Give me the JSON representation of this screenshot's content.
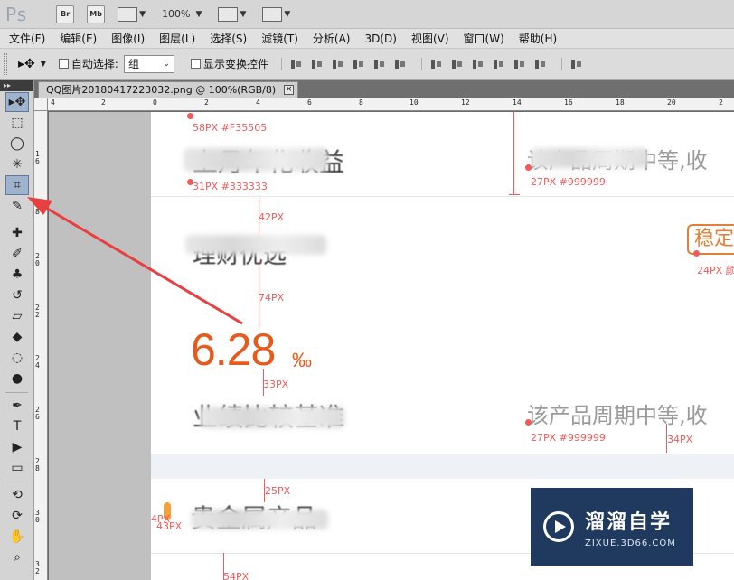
{
  "app": {
    "logo": "Ps",
    "bridge_label": "Br",
    "minibridge_label": "Mb",
    "zoom": "100%"
  },
  "menu": [
    "文件(F)",
    "编辑(E)",
    "图像(I)",
    "图层(L)",
    "选择(S)",
    "滤镜(T)",
    "分析(A)",
    "3D(D)",
    "视图(V)",
    "窗口(W)",
    "帮助(H)"
  ],
  "options": {
    "auto_select_label": "自动选择:",
    "auto_select_value": "组",
    "show_transform_label": "显示变换控件"
  },
  "document": {
    "tab_title": "QQ图片20180417223032.png @ 100%(RGB/8)",
    "close_glyph": "⊠"
  },
  "ruler": {
    "top_labels": [
      "4",
      "2",
      "0",
      "2",
      "4",
      "6",
      "8",
      "10",
      "12",
      "14",
      "16",
      "18",
      "20",
      "2"
    ],
    "left_labels": [
      "1\n6",
      "1\n8",
      "2\n0",
      "2\n2",
      "2\n4",
      "2\n6",
      "2\n8",
      "3\n0",
      "3\n2"
    ]
  },
  "canvas": {
    "heading1_tail": "上月年化收益",
    "heading2_tail": "理财优选",
    "rate_value": "6.28",
    "rate_unit": "‰",
    "heading3_tail": "业绩比较基准",
    "heading4_tail": "贵金属产品",
    "right_text_1": "该产品周期中等,收",
    "right_text_2": "该产品周期中等,收",
    "stable_tag": "稳定"
  },
  "annotations": {
    "a1": "58PX #F35505",
    "a2": "31PX #333333",
    "a3": "27PX #999999",
    "a4": "42PX",
    "a5": "74PX",
    "a6": "33PX",
    "a7": "27PX #999999",
    "a8": "34PX",
    "a9": "25PX",
    "a10": "4PX",
    "a11": "43PX",
    "a12": "54PX",
    "a13": "24PX 颜"
  },
  "watermark": {
    "title": "溜溜自学",
    "url": "ZIXUE.3D66.COM"
  },
  "colors": {
    "accent_orange": "#e85a1c",
    "annotation_red": "#f05a5a",
    "watermark_bg": "#1f3a5e"
  },
  "tools": [
    "move-icon",
    "marquee-icon",
    "lasso-icon",
    "magic-wand-icon",
    "crop-icon",
    "eyedropper-icon",
    "healing-brush-icon",
    "brush-icon",
    "clone-stamp-icon",
    "history-brush-icon",
    "eraser-icon",
    "paint-bucket-icon",
    "blur-icon",
    "dodge-icon",
    "pen-icon",
    "type-icon",
    "path-select-icon",
    "rectangle-icon",
    "3d-rotate-icon",
    "3d-orbit-icon",
    "hand-icon",
    "zoom-icon"
  ]
}
